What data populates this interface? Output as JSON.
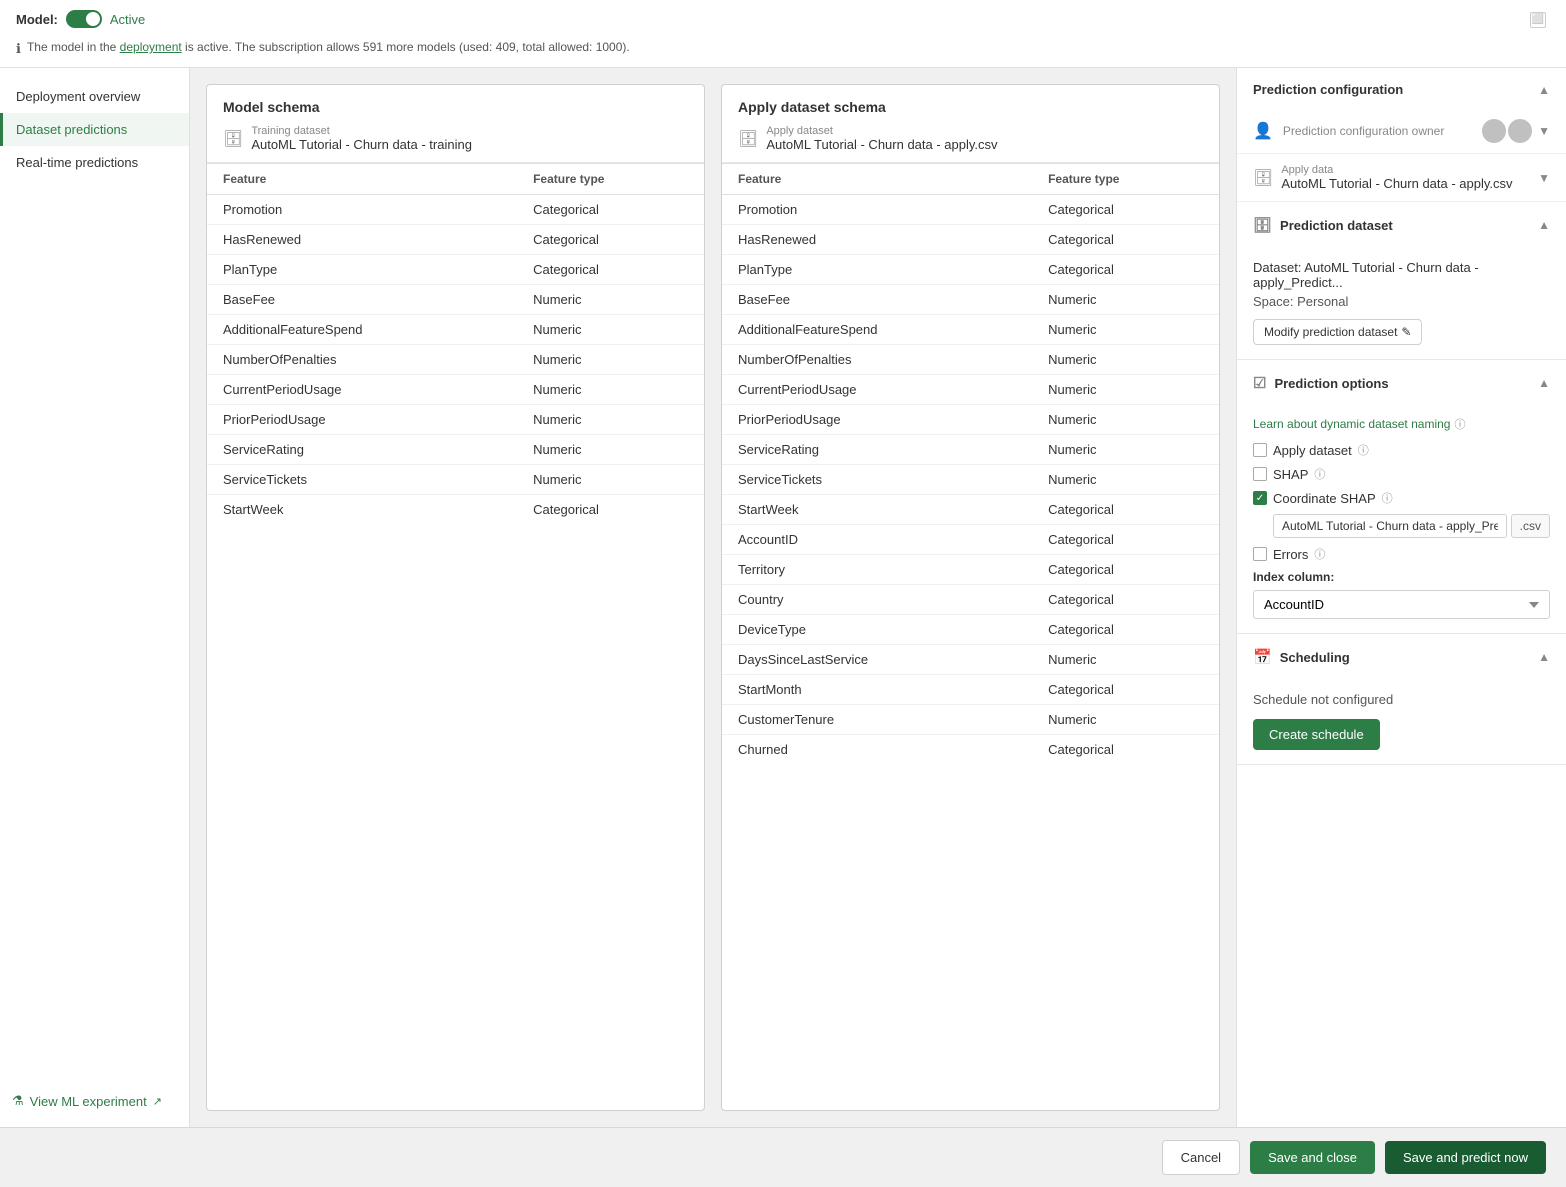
{
  "header": {
    "model_label": "Model:",
    "toggle_state": "Active",
    "info_text_before": "The model in the ",
    "info_link": "deployment",
    "info_text_after": " is active. The subscription allows 591 more models (used: 409, total allowed: 1000)."
  },
  "sidebar": {
    "items": [
      {
        "id": "deployment-overview",
        "label": "Deployment overview",
        "active": false
      },
      {
        "id": "dataset-predictions",
        "label": "Dataset predictions",
        "active": true
      },
      {
        "id": "realtime-predictions",
        "label": "Real-time predictions",
        "active": false
      }
    ]
  },
  "model_schema": {
    "title": "Model schema",
    "dataset_label": "Training dataset",
    "dataset_name": "AutoML Tutorial - Churn data - training",
    "columns": [
      "Feature",
      "Feature type"
    ],
    "rows": [
      [
        "Promotion",
        "Categorical"
      ],
      [
        "HasRenewed",
        "Categorical"
      ],
      [
        "PlanType",
        "Categorical"
      ],
      [
        "BaseFee",
        "Numeric"
      ],
      [
        "AdditionalFeatureSpend",
        "Numeric"
      ],
      [
        "NumberOfPenalties",
        "Numeric"
      ],
      [
        "CurrentPeriodUsage",
        "Numeric"
      ],
      [
        "PriorPeriodUsage",
        "Numeric"
      ],
      [
        "ServiceRating",
        "Numeric"
      ],
      [
        "ServiceTickets",
        "Numeric"
      ],
      [
        "StartWeek",
        "Categorical"
      ]
    ]
  },
  "apply_schema": {
    "title": "Apply dataset schema",
    "dataset_label": "Apply dataset",
    "dataset_name": "AutoML Tutorial - Churn data - apply.csv",
    "columns": [
      "Feature",
      "Feature type"
    ],
    "rows": [
      [
        "Promotion",
        "Categorical"
      ],
      [
        "HasRenewed",
        "Categorical"
      ],
      [
        "PlanType",
        "Categorical"
      ],
      [
        "BaseFee",
        "Numeric"
      ],
      [
        "AdditionalFeatureSpend",
        "Numeric"
      ],
      [
        "NumberOfPenalties",
        "Numeric"
      ],
      [
        "CurrentPeriodUsage",
        "Numeric"
      ],
      [
        "PriorPeriodUsage",
        "Numeric"
      ],
      [
        "ServiceRating",
        "Numeric"
      ],
      [
        "ServiceTickets",
        "Numeric"
      ],
      [
        "StartWeek",
        "Categorical"
      ],
      [
        "AccountID",
        "Categorical"
      ],
      [
        "Territory",
        "Categorical"
      ],
      [
        "Country",
        "Categorical"
      ],
      [
        "DeviceType",
        "Categorical"
      ],
      [
        "DaysSinceLastService",
        "Numeric"
      ],
      [
        "StartMonth",
        "Categorical"
      ],
      [
        "CustomerTenure",
        "Numeric"
      ],
      [
        "Churned",
        "Categorical"
      ]
    ]
  },
  "view_experiment": {
    "label": "View ML experiment",
    "icon": "🔬"
  },
  "right_panel": {
    "prediction_config": {
      "title": "Prediction configuration",
      "owner_label": "Prediction configuration owner",
      "apply_data_label": "Apply data",
      "apply_data_value": "AutoML Tutorial - Churn data - apply.csv",
      "prediction_dataset_label": "Prediction dataset",
      "dataset_text": "Dataset: AutoML Tutorial - Churn data - apply_Predict...",
      "space_text": "Space: Personal",
      "modify_btn_label": "Modify prediction dataset"
    },
    "prediction_options": {
      "title": "Prediction options",
      "learn_link": "Learn about dynamic dataset naming",
      "apply_dataset_label": "Apply dataset",
      "shap_label": "SHAP",
      "coordinate_shap_label": "Coordinate SHAP",
      "coordinate_shap_value": "AutoML Tutorial - Churn data - apply_Predictic",
      "csv_label": ".csv",
      "errors_label": "Errors",
      "index_column_label": "Index column:",
      "index_column_value": "AccountID"
    },
    "scheduling": {
      "title": "Scheduling",
      "schedule_text": "Schedule not configured",
      "create_btn_label": "Create schedule"
    }
  },
  "footer": {
    "cancel_label": "Cancel",
    "save_close_label": "Save and close",
    "save_predict_label": "Save and predict now"
  }
}
